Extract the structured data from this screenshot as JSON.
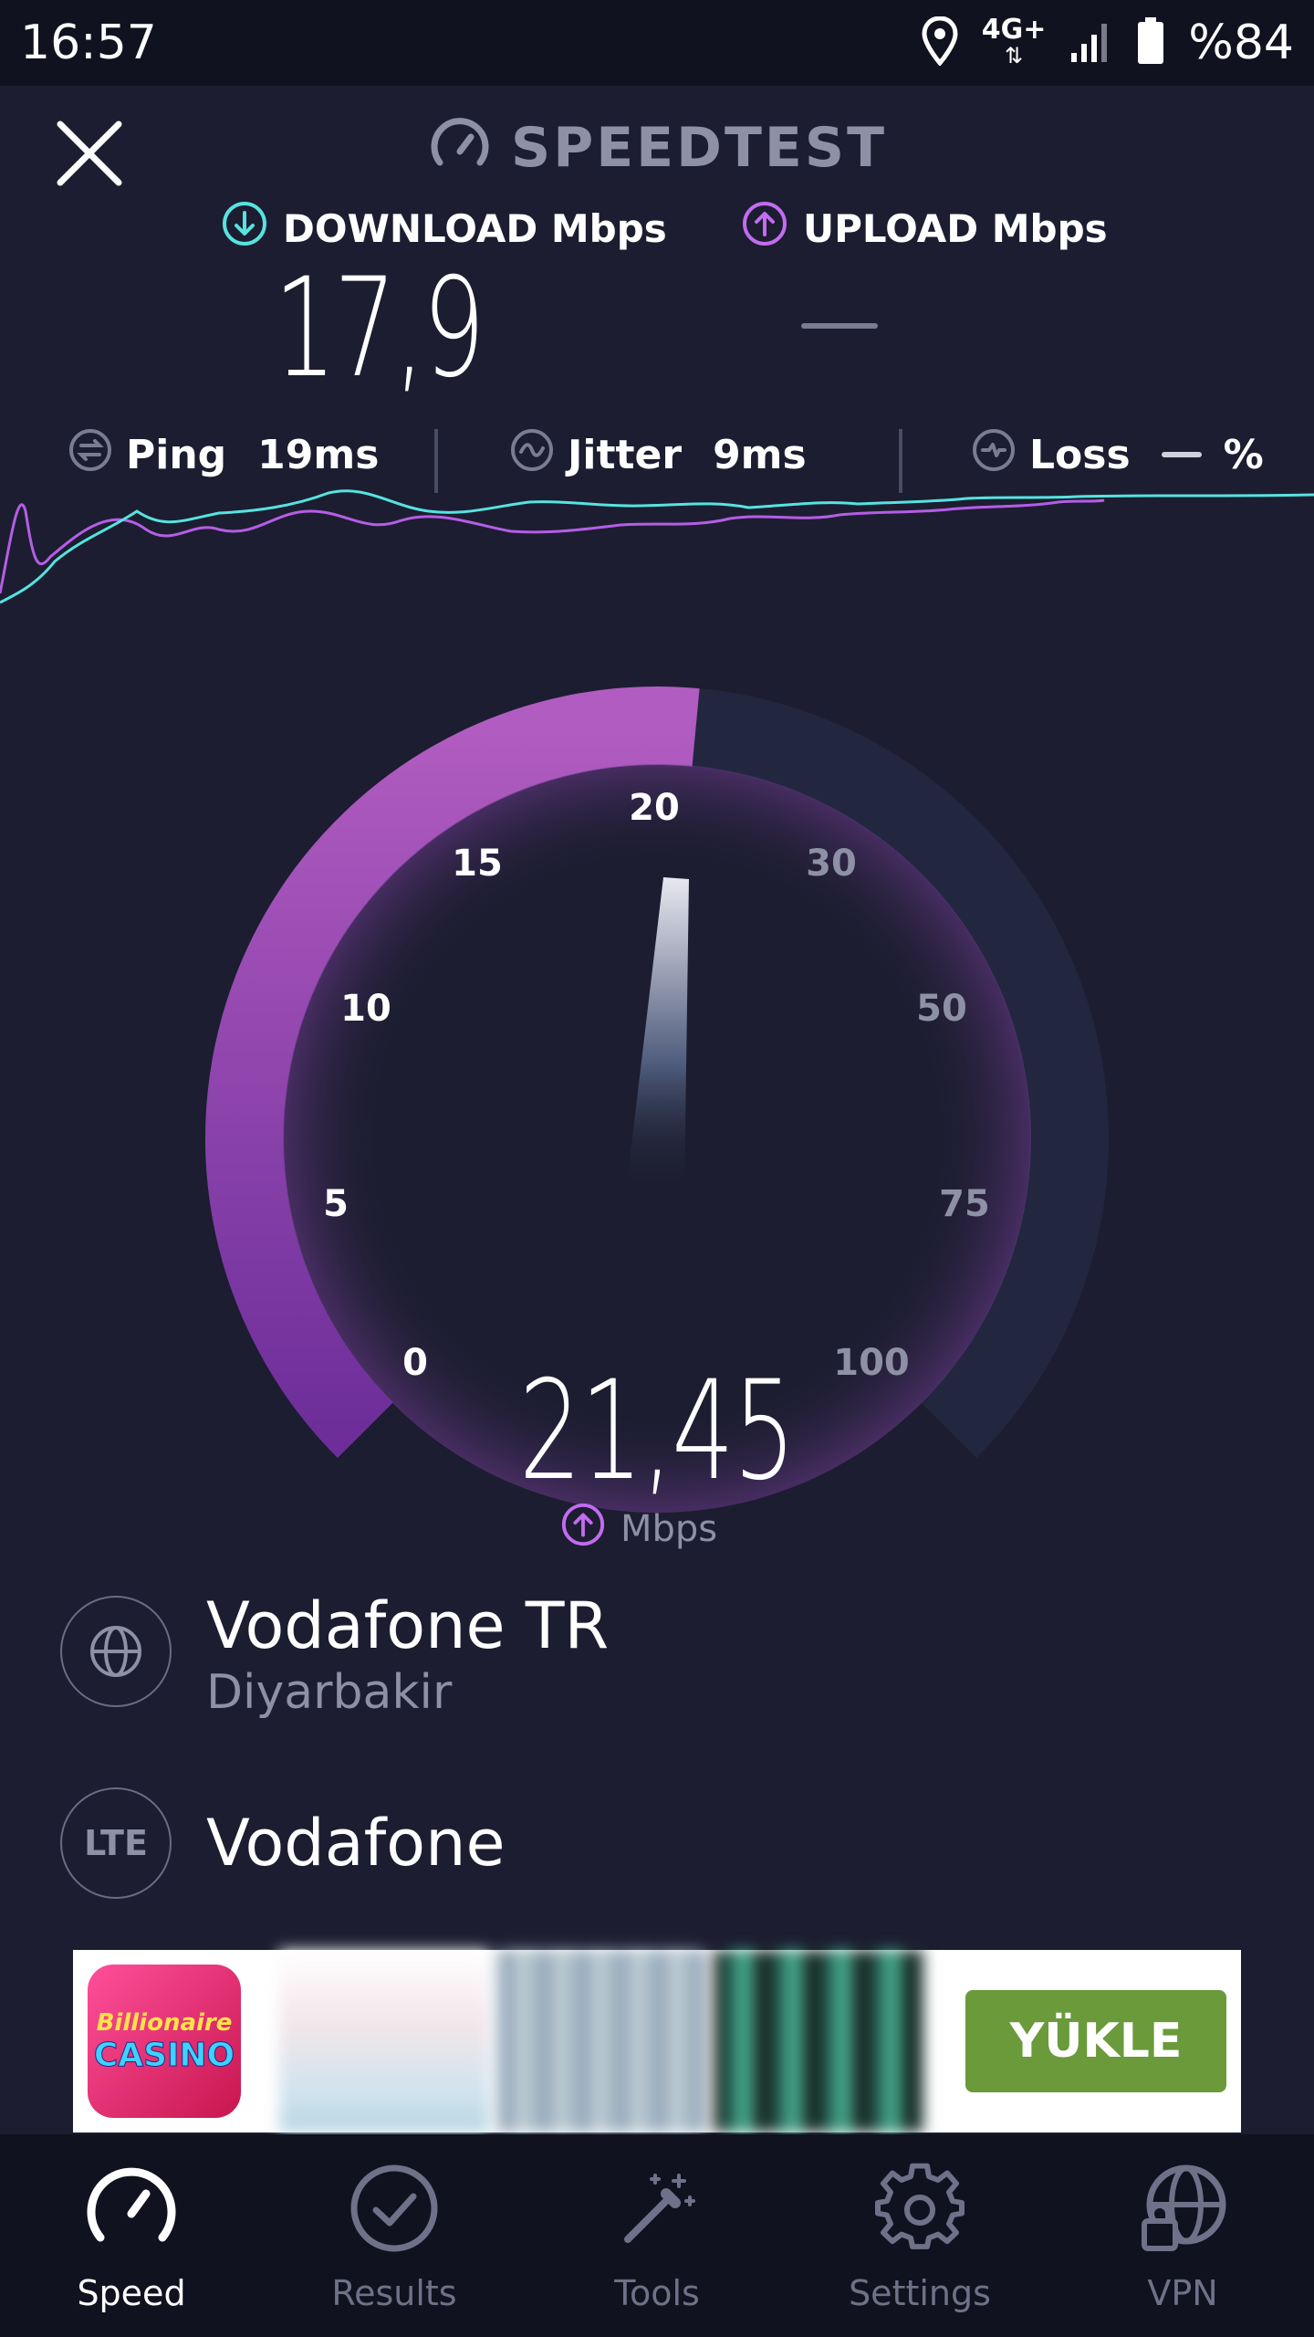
{
  "status_bar": {
    "time": "16:57",
    "network": "4G+",
    "battery": "%84"
  },
  "header": {
    "title": "SPEEDTEST",
    "close_icon": "close-icon",
    "logo_icon": "speedometer-icon"
  },
  "results": {
    "download_label": "DOWNLOAD Mbps",
    "upload_label": "UPLOAD Mbps",
    "download_value": "17,9",
    "upload_value": "—"
  },
  "stats": {
    "ping_label": "Ping",
    "ping_value": "19ms",
    "jitter_label": "Jitter",
    "jitter_value": "9ms",
    "loss_label": "Loss",
    "loss_value": "%"
  },
  "gauge": {
    "value": "21,45",
    "unit": "Mbps",
    "ticks": [
      "0",
      "5",
      "10",
      "15",
      "20",
      "30",
      "50",
      "75",
      "100"
    ],
    "fill_fraction": 0.52
  },
  "provider": {
    "isp_name": "Vodafone TR",
    "isp_location": "Diyarbakir",
    "network_type": "LTE",
    "network_name": "Vodafone"
  },
  "ad": {
    "logo_top": "Billionaire",
    "logo_bottom": "CASINO",
    "install_label": "YÜKLE"
  },
  "nav": {
    "items": [
      {
        "label": "Speed",
        "icon": "speed-icon",
        "active": true
      },
      {
        "label": "Results",
        "icon": "check-circle-icon",
        "active": false
      },
      {
        "label": "Tools",
        "icon": "magic-wand-icon",
        "active": false
      },
      {
        "label": "Settings",
        "icon": "gear-icon",
        "active": false
      },
      {
        "label": "VPN",
        "icon": "globe-lock-icon",
        "active": false
      }
    ]
  },
  "colors": {
    "background": "#1c1d30",
    "download_accent": "#56e3e0",
    "upload_accent": "#c26cf0",
    "gauge_fill": "#9b4fbe",
    "gauge_track": "#22273f",
    "install_button": "#6a9a3a"
  }
}
